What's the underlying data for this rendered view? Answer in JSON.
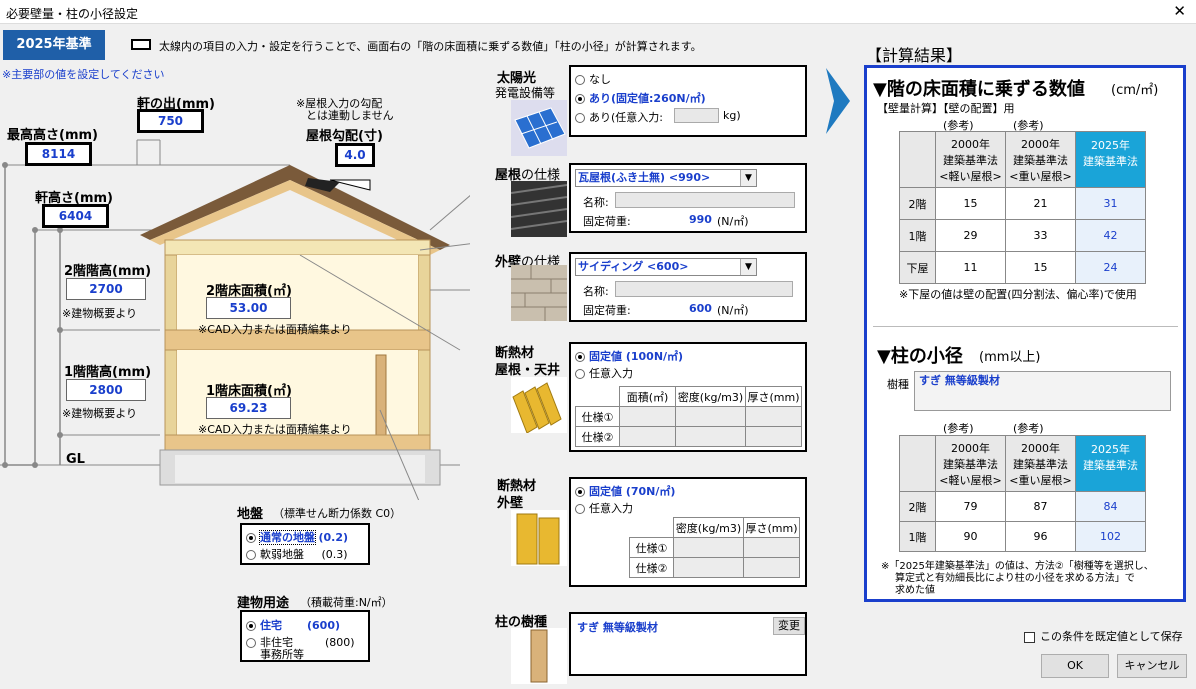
{
  "window": {
    "title": "必要壁量・柱の小径設定",
    "close": "✕"
  },
  "badge": "2025年基準",
  "instruction": "太線内の項目の入力・設定を行うことで、画面右の「階の床面積に乗ずる数値」「柱の小径」が計算されます。",
  "note_main": "※主要部の値を設定してください",
  "building": {
    "eave_out_label": "軒の出(mm)",
    "eave_out": "750",
    "max_height_label": "最高高さ(mm)",
    "max_height": "8114",
    "roof_note1": "※屋根入力の勾配",
    "roof_note2": "とは連動しません",
    "roof_pitch_label": "屋根勾配(寸)",
    "roof_pitch": "4.0",
    "eave_height_label": "軒高さ(mm)",
    "eave_height": "6404",
    "f2_height_label": "2階階高(mm)",
    "f2_height": "2700",
    "f2_height_note": "※建物概要より",
    "f2_area_label": "2階床面積(㎡)",
    "f2_area": "53.00",
    "f2_area_note": "※CAD入力または面積編集より",
    "f1_height_label": "1階階高(mm)",
    "f1_height": "2800",
    "f1_height_note": "※建物概要より",
    "f1_area_label": "1階床面積(㎡)",
    "f1_area": "69.23",
    "f1_area_note": "※CAD入力または面積編集より",
    "gl": "GL"
  },
  "ground": {
    "label": "地盤",
    "sub": "（標準せん断力係数 C0）",
    "opt1": "通常の地盤",
    "opt1v": "(0.2)",
    "opt2": "軟弱地盤",
    "opt2v": "(0.3)"
  },
  "usage": {
    "label": "建物用途",
    "sub": "（積載荷重:N/㎡）",
    "opt1": "住宅",
    "opt1v": "(600)",
    "opt2a": "非住宅",
    "opt2b": "事務所等",
    "opt2v": "(800)"
  },
  "solar": {
    "label1": "太陽光",
    "label2": "発電設備等",
    "opt1": "なし",
    "opt2": "あり(固定値:260N/㎡)",
    "opt3": "あり(任意入力:",
    "opt3unit": "kg)"
  },
  "roof": {
    "label1": "屋根",
    "label2": "の仕様",
    "select": "瓦屋根(ふき土無) <990>",
    "name_label": "名称:",
    "load_label": "固定荷重:",
    "load": "990",
    "unit": "(N/㎡)"
  },
  "wall": {
    "label1": "外壁",
    "label2": "の仕様",
    "select": "サイディング <600>",
    "name_label": "名称:",
    "load_label": "固定荷重:",
    "load": "600",
    "unit": "(N/㎡)"
  },
  "ins_roof": {
    "label1": "断熱材",
    "label2": "屋根・天井",
    "opt1": "固定値 (100N/㎡)",
    "opt2": "任意入力",
    "h1": "面積(㎡)",
    "h2": "密度(kg/m3)",
    "h3": "厚さ(mm)",
    "r1": "仕様①",
    "r2": "仕様②"
  },
  "ins_wall": {
    "label1": "断熱材",
    "label2": "外壁",
    "opt1": "固定値 (70N/㎡)",
    "opt2": "任意入力",
    "h1": "密度(kg/m3)",
    "h2": "厚さ(mm)",
    "r1": "仕様①",
    "r2": "仕様②"
  },
  "pillar": {
    "label": "柱の樹種",
    "value": "すぎ 無等級製材",
    "btn": "変更"
  },
  "result": {
    "title": "【計算結果】",
    "sec1": "▼階の床面積に乗ずる数値",
    "sec1unit": "(cm/㎡)",
    "sec1sub": "【壁量計算】【壁の配置】用",
    "ref": "(参考)",
    "h1": [
      "2000年",
      "建築基準法",
      "<軽い屋根>"
    ],
    "h2": [
      "2000年",
      "建築基準法",
      "<重い屋根>"
    ],
    "h3": [
      "2025年",
      "建築基準法"
    ],
    "rows1": [
      {
        "f": "2階",
        "a": "15",
        "b": "21",
        "c": "31"
      },
      {
        "f": "1階",
        "a": "29",
        "b": "33",
        "c": "42"
      },
      {
        "f": "下屋",
        "a": "11",
        "b": "15",
        "c": "24"
      }
    ],
    "note1": "※下屋の値は壁の配置(四分割法、偏心率)で使用",
    "sec2": "▼柱の小径",
    "sec2unit": "(mm以上)",
    "species_label": "樹種",
    "species": "すぎ 無等級製材",
    "rows2": [
      {
        "f": "2階",
        "a": "79",
        "b": "87",
        "c": "84"
      },
      {
        "f": "1階",
        "a": "90",
        "b": "96",
        "c": "102"
      }
    ],
    "note2a": "※「2025年建築基準法」の値は、方法②「樹種等を選択し、",
    "note2b": "算定式と有効細長比により柱の小径を求める方法」で",
    "note2c": "求めた値"
  },
  "footer": {
    "default_check": "この条件を既定値として保存",
    "ok": "OK",
    "cancel": "キャンセル"
  }
}
